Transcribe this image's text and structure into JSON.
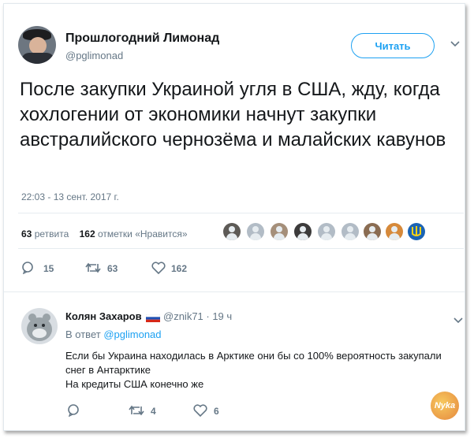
{
  "tweet": {
    "author_name": "Прошлогодний Лимонад",
    "author_handle": "@pglimonad",
    "follow_label": "Читать",
    "text": "После закупки Украиной угля в США, жду, когда хохлогении от экономики  начнут закупки австралийского чернозёма и малайских кавунов",
    "timestamp": "22:03 - 13 сент. 2017 г.",
    "retweets_count": "63",
    "retweets_label": "ретвита",
    "likes_count": "162",
    "likes_label": "отметки «Нравится»",
    "actions": {
      "replies": "15",
      "retweets": "63",
      "likes": "162"
    }
  },
  "reply": {
    "author_name": "Колян Захаров",
    "author_handle_time": "@znik71 · 19 ч",
    "in_reply_prefix": "В ответ",
    "in_reply_handle": "@pglimonad",
    "text_lines": [
      "Если бы Украина находилась в Арктике они бы со 100% вероятность закупали",
      "снег в Антарктике",
      "На кредиты США конечно же"
    ],
    "actions": {
      "replies": "",
      "retweets": "4",
      "likes": "6"
    }
  },
  "watermark": "Nyka",
  "colors": {
    "accent": "#1da1f2",
    "muted": "#657786",
    "text": "#14171a",
    "border": "#e6ecf0"
  },
  "icons": [
    "chevron-down-icon",
    "reply-icon",
    "retweet-icon",
    "like-icon"
  ]
}
